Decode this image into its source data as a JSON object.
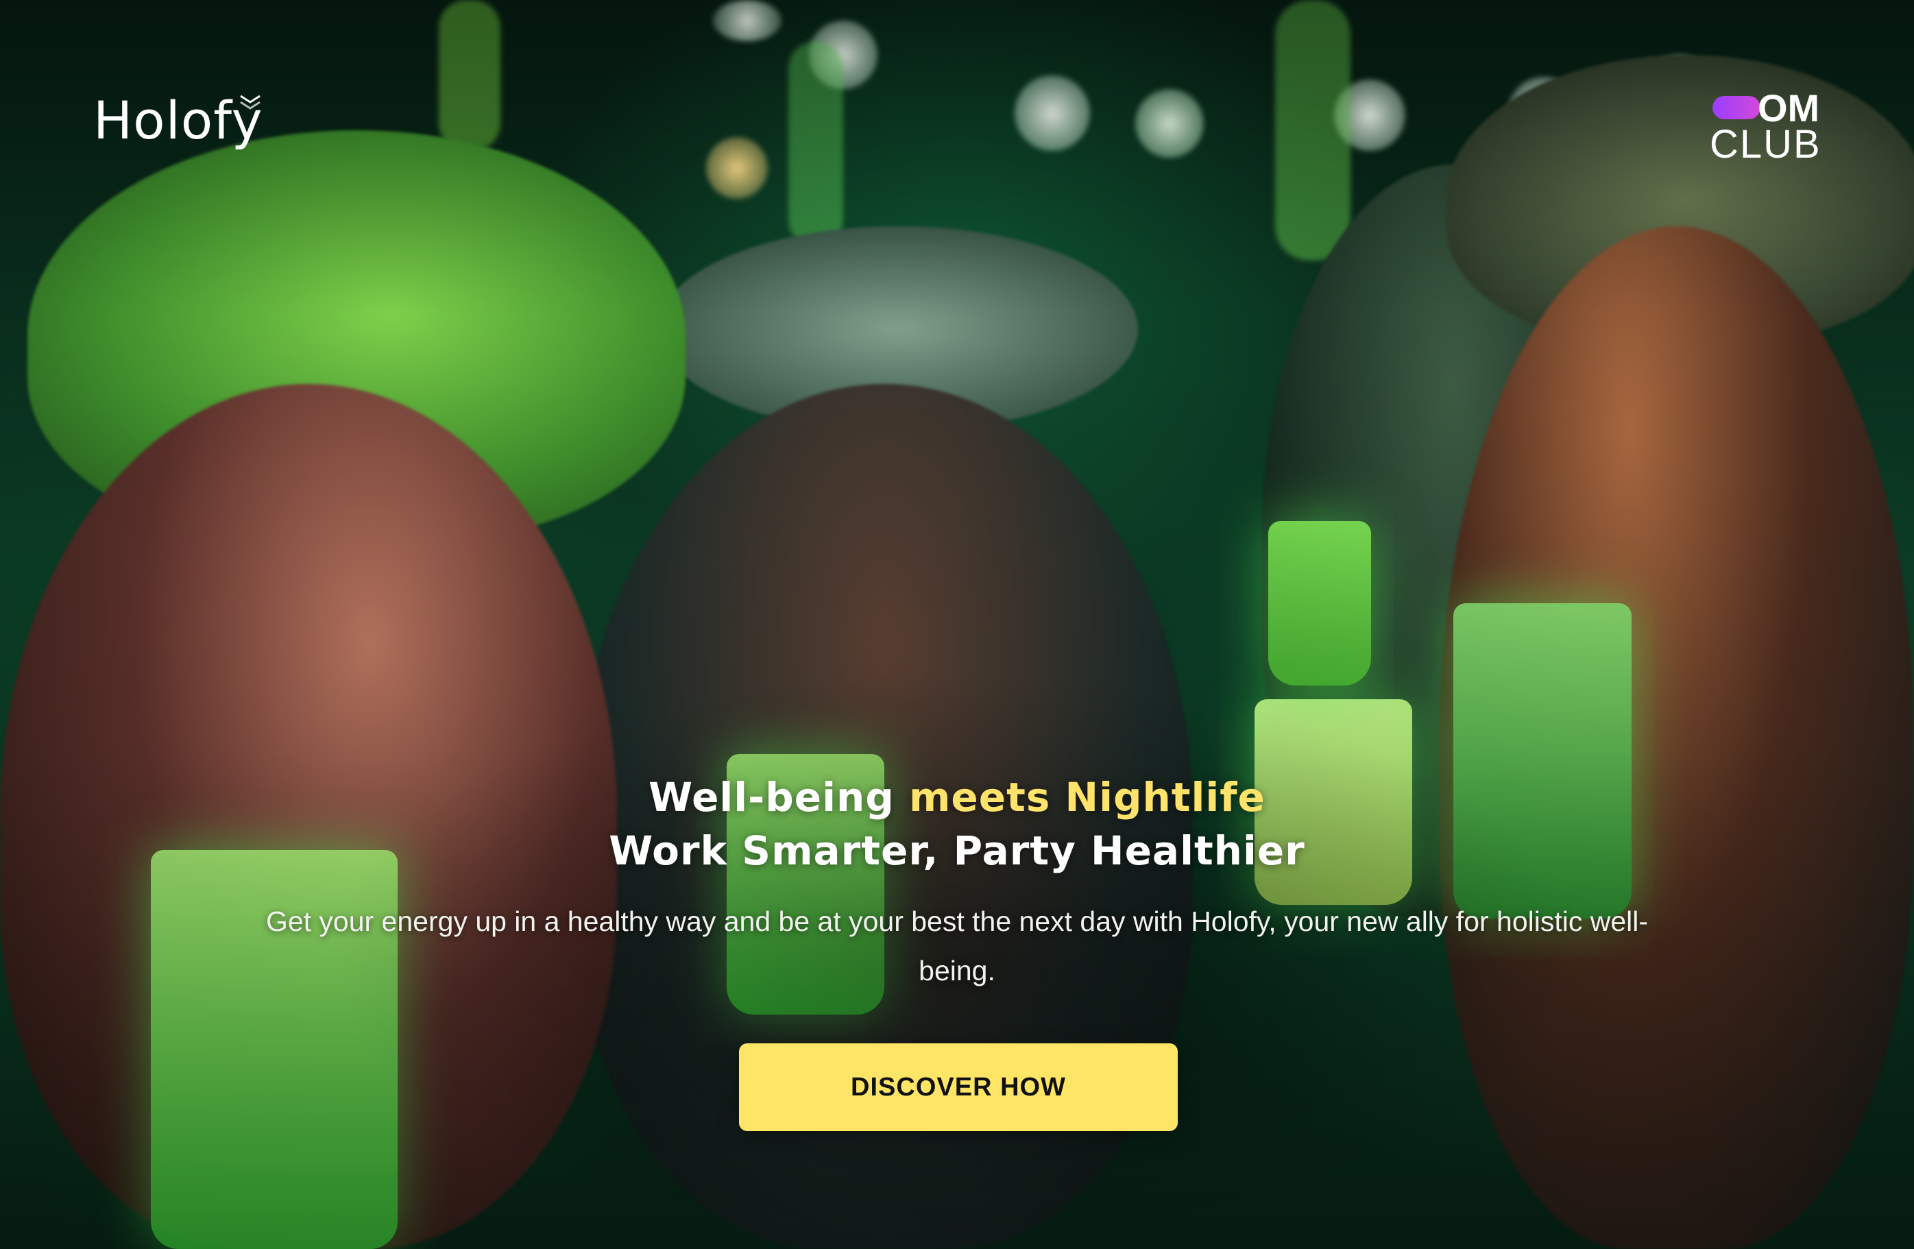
{
  "header": {
    "brand_name": "Holofy",
    "partner_logo_top": "OM",
    "partner_logo_bottom": "CLUB"
  },
  "hero": {
    "background": "photo-of-friends-toasting-green-drinks-at-night-party",
    "headline_part_1": "Well-being ",
    "headline_accent": "meets Nightlife",
    "headline_line_2": "Work Smarter, Party Healthier",
    "subtext": "Get your energy up in a healthy way and be at your best the next day with Holofy, your new ally for holistic well-being.",
    "cta_label": "DISCOVER HOW"
  },
  "colors": {
    "accent_yellow": "#ffe36a",
    "cta_background": "#ffe566",
    "text_white": "#ffffff",
    "partner_pill_start": "#9b3dff",
    "partner_pill_end": "#d34ad8"
  }
}
